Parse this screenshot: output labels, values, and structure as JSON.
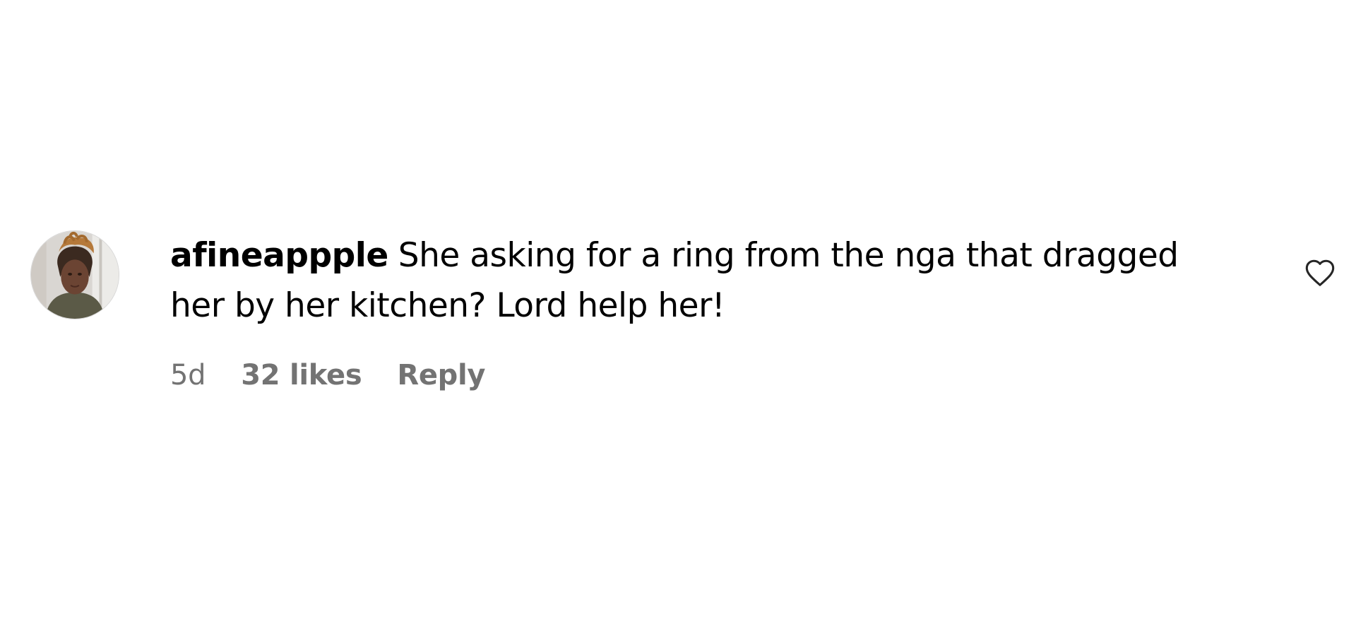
{
  "comment": {
    "username": "afineappple",
    "text": "She asking for a ring from the nga that dragged her by her kitchen? Lord help her!",
    "timestamp": "5d",
    "likes": "32 likes",
    "reply_label": "Reply",
    "like_icon": "heart-outline-icon",
    "avatar_icon": "user-avatar"
  },
  "colors": {
    "background": "#ffffff",
    "text": "#000000",
    "meta_text": "#737373"
  }
}
